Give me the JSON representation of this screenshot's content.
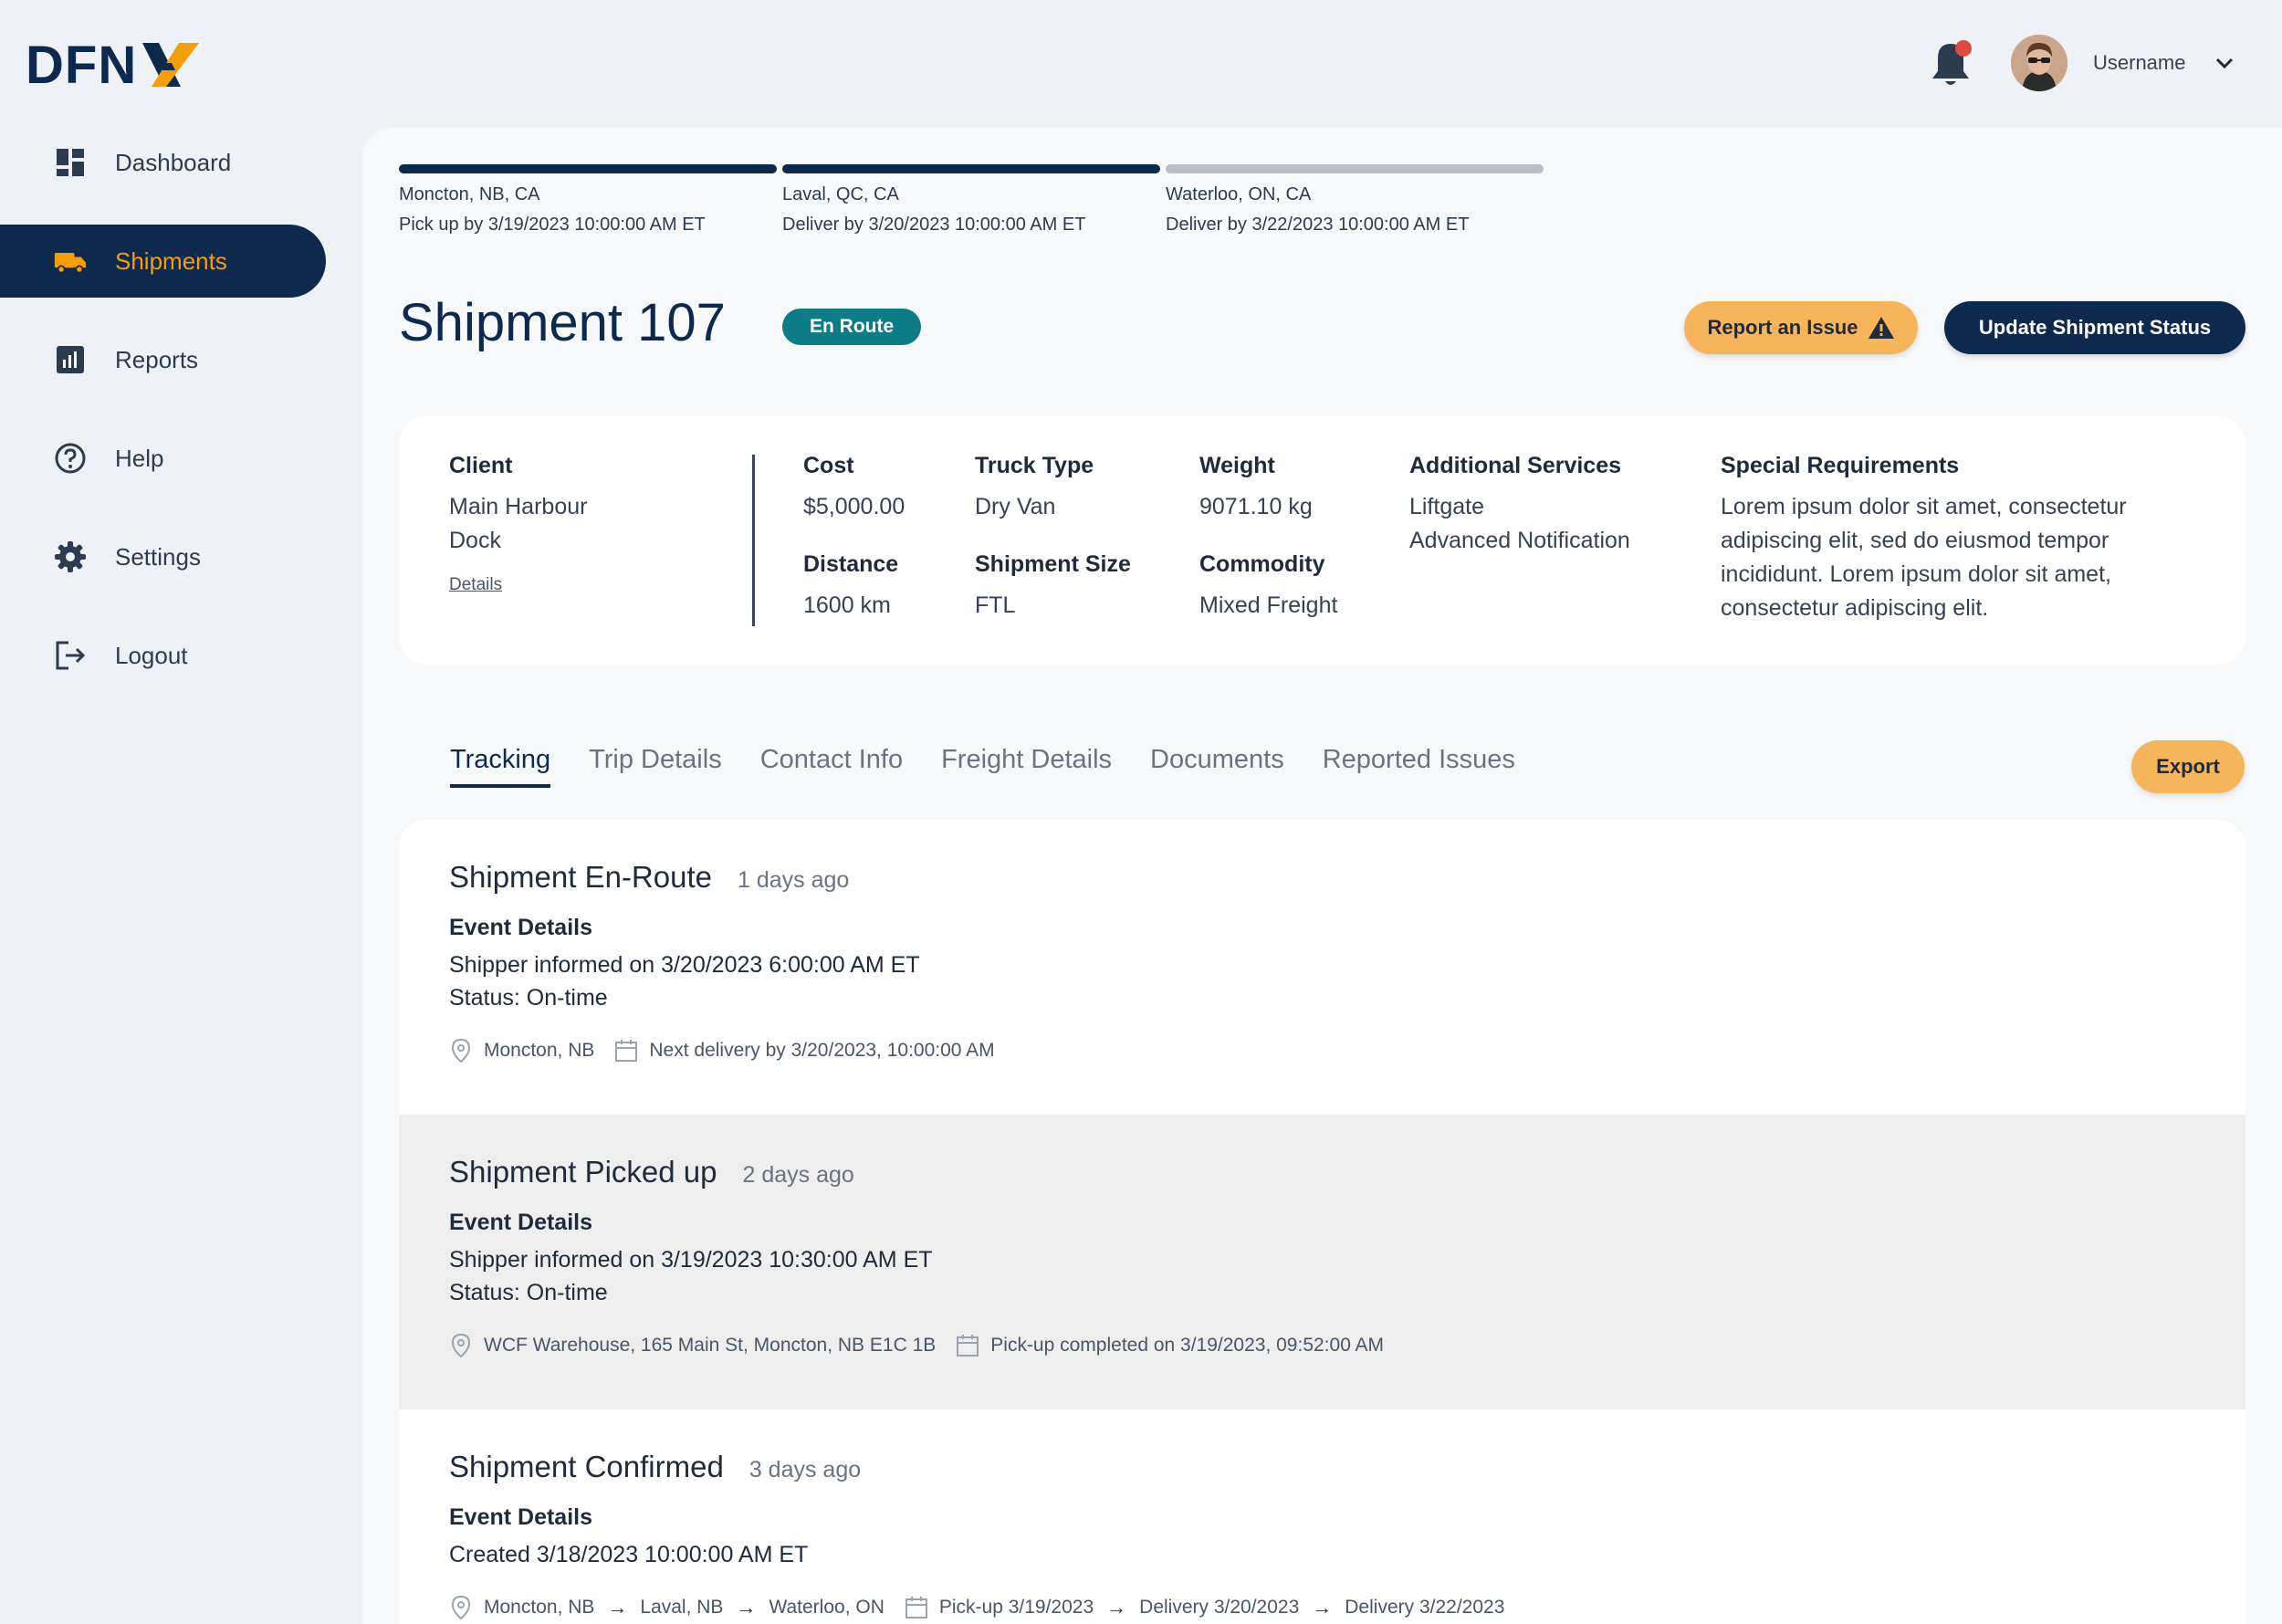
{
  "brand": {
    "logo_text": "DFN",
    "logo_mark": "X"
  },
  "sidebar": {
    "items": [
      {
        "label": "Dashboard",
        "icon": "dashboard-icon",
        "active": false
      },
      {
        "label": "Shipments",
        "icon": "truck-icon",
        "active": true
      },
      {
        "label": "Reports",
        "icon": "reports-icon",
        "active": false
      },
      {
        "label": "Help",
        "icon": "help-icon",
        "active": false
      },
      {
        "label": "Settings",
        "icon": "gear-icon",
        "active": false
      },
      {
        "label": "Logout",
        "icon": "logout-icon",
        "active": false
      }
    ]
  },
  "header": {
    "username": "Username",
    "notifications_unread": true
  },
  "route_progress": [
    {
      "location": "Moncton, NB, CA",
      "date": "Pick up by 3/19/2023 10:00:00 AM ET",
      "completed": true
    },
    {
      "location": "Laval, QC, CA",
      "date": "Deliver by 3/20/2023 10:00:00 AM ET",
      "completed": true
    },
    {
      "location": "Waterloo, ON, CA",
      "date": "Deliver by 3/22/2023 10:00:00 AM ET",
      "completed": false
    }
  ],
  "shipment": {
    "title": "Shipment 107",
    "status": "En Route",
    "report_issue_label": "Report an Issue",
    "update_status_label": "Update Shipment Status"
  },
  "summary": {
    "client_label": "Client",
    "client_value_line1": "Main Harbour",
    "client_value_line2": "Dock",
    "details_link": "Details",
    "cost_label": "Cost",
    "cost_value": "$5,000.00",
    "distance_label": "Distance",
    "distance_value": "1600 km",
    "truck_type_label": "Truck Type",
    "truck_type_value": "Dry Van",
    "shipment_size_label": "Shipment Size",
    "shipment_size_value": "FTL",
    "weight_label": "Weight",
    "weight_value": "9071.10 kg",
    "commodity_label": "Commodity",
    "commodity_value": "Mixed Freight",
    "additional_services_label": "Additional Services",
    "additional_services": [
      "Liftgate",
      "Advanced Notification"
    ],
    "special_requirements_label": "Special Requirements",
    "special_requirements_lines": [
      "Lorem ipsum dolor sit amet, consectetur",
      "adipiscing elit, sed do eiusmod tempor",
      "incididunt. Lorem ipsum dolor sit amet,",
      "consectetur adipiscing elit."
    ]
  },
  "tabs": {
    "items": [
      "Tracking",
      "Trip Details",
      "Contact Info",
      "Freight Details",
      "Documents",
      "Reported Issues"
    ],
    "active": "Tracking",
    "export_label": "Export"
  },
  "events": [
    {
      "title": "Shipment En-Route",
      "ago": "1 days ago",
      "details_label": "Event Details",
      "line1": "Shipper informed on 3/20/2023 6:00:00 AM ET",
      "line2": "Status: On-time",
      "location": "Moncton, NB",
      "date_note": "Next delivery by 3/20/2023, 10:00:00 AM"
    },
    {
      "title": "Shipment Picked up",
      "ago": "2 days ago",
      "details_label": "Event Details",
      "line1": "Shipper informed on 3/19/2023 10:30:00 AM ET",
      "line2": "Status: On-time",
      "location": "WCF Warehouse, 165 Main St, Moncton, NB E1C 1B",
      "date_note": "Pick-up completed on 3/19/2023, 09:52:00 AM"
    },
    {
      "title": "Shipment Confirmed",
      "ago": "3 days ago",
      "details_label": "Event Details",
      "line1": "Created 3/18/2023 10:00:00 AM ET",
      "route": [
        "Moncton, NB",
        "Laval, NB",
        "Waterloo, ON"
      ],
      "schedule": [
        "Pick-up 3/19/2023",
        "Delivery 3/20/2023",
        "Delivery 3/22/2023"
      ]
    }
  ],
  "colors": {
    "navy": "#0d2a4e",
    "accent_orange": "#f59e0b",
    "button_orange": "#f7b55b",
    "status_teal": "#0e7c86",
    "notification_red": "#e04a3c"
  }
}
